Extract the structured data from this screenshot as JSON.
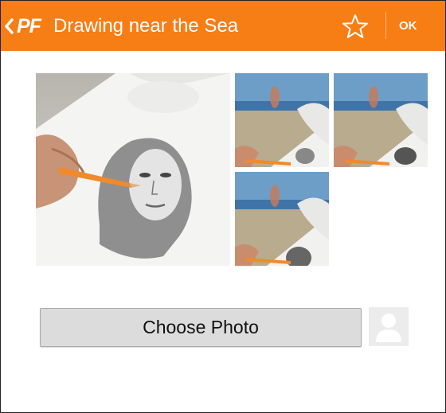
{
  "appbar": {
    "logo_text": "PF",
    "title": "Drawing near the Sea",
    "ok_label": "OK",
    "background_color": "#f77d15",
    "icons": [
      "chevron-left-icon",
      "star-icon"
    ]
  },
  "gallery": {
    "images": [
      {
        "name": "preview-main",
        "subject": "pencil portrait sketch"
      },
      {
        "name": "preview-beach-1",
        "subject": "sketch at the beach"
      },
      {
        "name": "preview-beach-2",
        "subject": "sketch at the beach"
      },
      {
        "name": "preview-beach-3",
        "subject": "sketch at the beach"
      }
    ]
  },
  "actions": {
    "choose_photo_label": "Choose Photo",
    "avatar_icon": "person-placeholder-icon"
  }
}
